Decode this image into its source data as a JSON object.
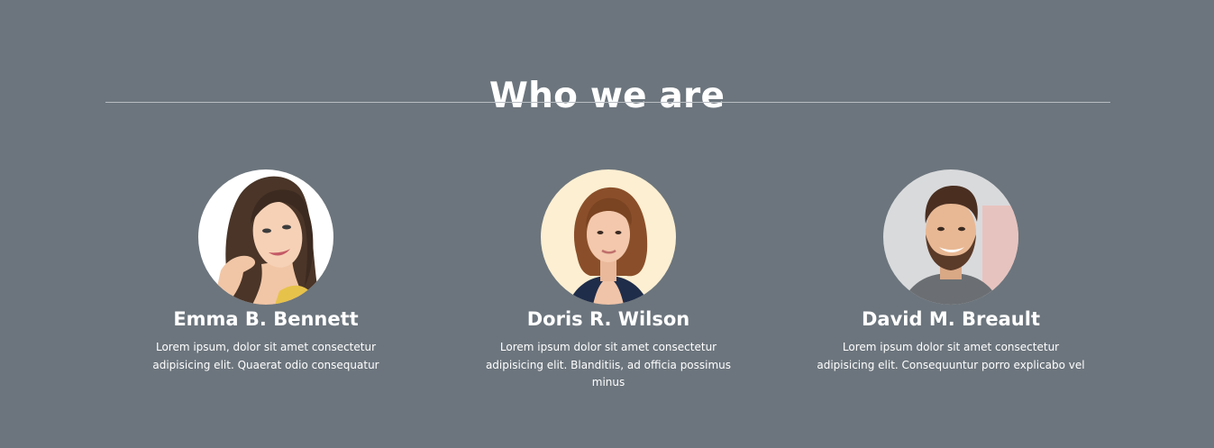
{
  "section": {
    "title": "Who we are"
  },
  "members": [
    {
      "name": "Emma B. Bennett",
      "bio": "Lorem ipsum, dolor sit amet consectetur adipisicing elit. Quaerat odio consequatur"
    },
    {
      "name": "Doris R. Wilson",
      "bio": "Lorem ipsum dolor sit amet consectetur adipisicing elit. Blanditiis, ad officia possimus minus"
    },
    {
      "name": "David M. Breault",
      "bio": "Lorem ipsum dolor sit amet consectetur adipisicing elit. Consequuntur porro explicabo vel"
    }
  ]
}
